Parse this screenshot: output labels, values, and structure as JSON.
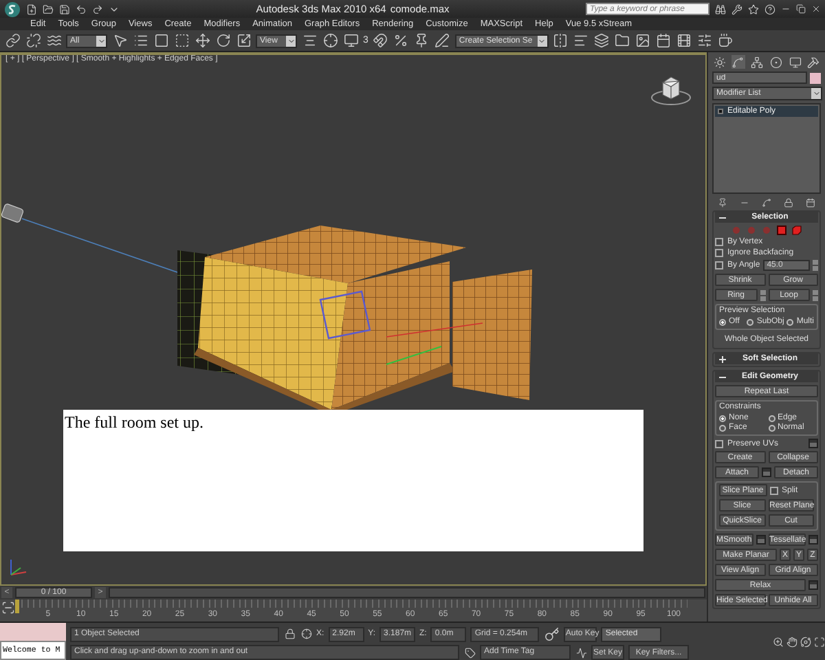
{
  "title_bar": {
    "app_title": "Autodesk 3ds Max  2010 x64",
    "file_name": "comode.max",
    "search": {
      "placeholder": "Type a keyword or phrase"
    }
  },
  "menu": [
    "Edit",
    "Tools",
    "Group",
    "Views",
    "Create",
    "Modifiers",
    "Animation",
    "Graph Editors",
    "Rendering",
    "Customize",
    "MAXScript",
    "Help",
    "Vue 9.5 xStream"
  ],
  "toolbar": {
    "selection_filter": "All",
    "reference_coord": "View",
    "snap_label": "3",
    "named_selection": "Create Selection Se"
  },
  "viewport": {
    "label": "[ + ] [ Perspective ] [ Smooth + Highlights + Edged Faces ]",
    "caption": "The full room set up."
  },
  "command_panel": {
    "object_name": "ud",
    "modifier_list": "Modifier List",
    "stack": [
      {
        "label": "Editable Poly",
        "selected": true
      }
    ],
    "rollouts": [
      {
        "title": "Selection",
        "expanded": true,
        "rows": [
          {
            "kind": "subobjects"
          },
          {
            "kind": "check",
            "label": "By Vertex",
            "checked": false
          },
          {
            "kind": "check",
            "label": "Ignore Backfacing",
            "checked": false
          },
          {
            "kind": "check",
            "label": "By Angle",
            "checked": false,
            "value": "45.0"
          },
          {
            "kind": "buttons",
            "items": [
              {
                "kind": "button",
                "label": "Shrink"
              },
              {
                "kind": "button",
                "label": "Grow"
              }
            ]
          },
          {
            "kind": "buttons",
            "items": [
              {
                "kind": "spin",
                "label": "Ring"
              },
              {
                "kind": "spin",
                "label": "Loop"
              }
            ]
          },
          {
            "kind": "radios",
            "title": "Preview Selection",
            "options": [
              {
                "label": "Off",
                "selected": true
              },
              {
                "label": "SubObj",
                "selected": false
              },
              {
                "label": "Multi",
                "selected": false
              }
            ]
          },
          {
            "kind": "text",
            "text": "Whole Object Selected"
          }
        ]
      },
      {
        "title": "Soft Selection",
        "expanded": false
      },
      {
        "title": "Edit Geometry",
        "expanded": true,
        "rows": [
          {
            "kind": "buttons",
            "items": [
              {
                "kind": "button",
                "label": "Repeat Last"
              }
            ]
          },
          {
            "kind": "radios",
            "title": "Constraints",
            "options": [
              {
                "label": "None",
                "selected": true
              },
              {
                "label": "Edge",
                "selected": false
              },
              {
                "label": "Face",
                "selected": false
              },
              {
                "label": "Normal",
                "selected": false
              }
            ]
          },
          {
            "kind": "check",
            "label": "Preserve UVs",
            "checked": false,
            "settings": true
          },
          {
            "kind": "buttons",
            "items": [
              {
                "kind": "button",
                "label": "Create"
              },
              {
                "kind": "button",
                "label": "Collapse"
              }
            ]
          },
          {
            "kind": "buttons",
            "items": [
              {
                "kind": "settings",
                "label": "Attach"
              },
              {
                "kind": "button",
                "label": "Detach"
              }
            ]
          },
          {
            "kind": "group",
            "rows": [
              {
                "kind": "buttons",
                "items": [
                  {
                    "kind": "button",
                    "label": "Slice Plane"
                  },
                  {
                    "kind": "check",
                    "label": "Split",
                    "checked": false
                  }
                ]
              },
              {
                "kind": "buttons",
                "items": [
                  {
                    "kind": "button",
                    "label": "Slice"
                  },
                  {
                    "kind": "button",
                    "label": "Reset Plane"
                  }
                ]
              },
              {
                "kind": "buttons",
                "items": [
                  {
                    "kind": "button",
                    "label": "QuickSlice"
                  },
                  {
                    "kind": "button",
                    "label": "Cut"
                  }
                ]
              }
            ]
          },
          {
            "kind": "buttons",
            "items": [
              {
                "kind": "settings",
                "label": "MSmooth"
              },
              {
                "kind": "settings",
                "label": "Tessellate"
              }
            ]
          },
          {
            "kind": "buttons",
            "items": [
              {
                "kind": "button",
                "label": "Make Planar"
              },
              {
                "kind": "small",
                "label": "X"
              },
              {
                "kind": "small",
                "label": "Y"
              },
              {
                "kind": "small",
                "label": "Z"
              }
            ]
          },
          {
            "kind": "buttons",
            "items": [
              {
                "kind": "button",
                "label": "View Align"
              },
              {
                "kind": "button",
                "label": "Grid Align"
              }
            ]
          },
          {
            "kind": "buttons",
            "items": [
              {
                "kind": "settings",
                "label": "Relax"
              }
            ]
          },
          {
            "kind": "buttons",
            "items": [
              {
                "kind": "button",
                "label": "Hide Selected"
              },
              {
                "kind": "button",
                "label": "Unhide All"
              }
            ]
          }
        ]
      }
    ]
  },
  "time_slider": {
    "prev": "<",
    "position": "0 / 100",
    "next": ">"
  },
  "ruler": [
    "5",
    "10",
    "15",
    "20",
    "25",
    "30",
    "35",
    "40",
    "45",
    "50",
    "55",
    "60",
    "65",
    "70",
    "75",
    "80",
    "85",
    "90",
    "95",
    "100"
  ],
  "status": {
    "listener": "Welcome to M",
    "selection": "1 Object Selected",
    "prompt": "Click and drag up-and-down to zoom in and out",
    "coords": [
      {
        "axis": "X:",
        "value": "2.92m"
      },
      {
        "axis": "Y:",
        "value": "3.187m"
      },
      {
        "axis": "Z:",
        "value": "0.0m"
      }
    ],
    "grid": "Grid = 0.254m",
    "add_time_tag": "Add Time Tag",
    "auto_key": "Auto Key",
    "key_mode": "Selected",
    "set_key": "Set Key",
    "key_filters": "Key Filters..."
  }
}
